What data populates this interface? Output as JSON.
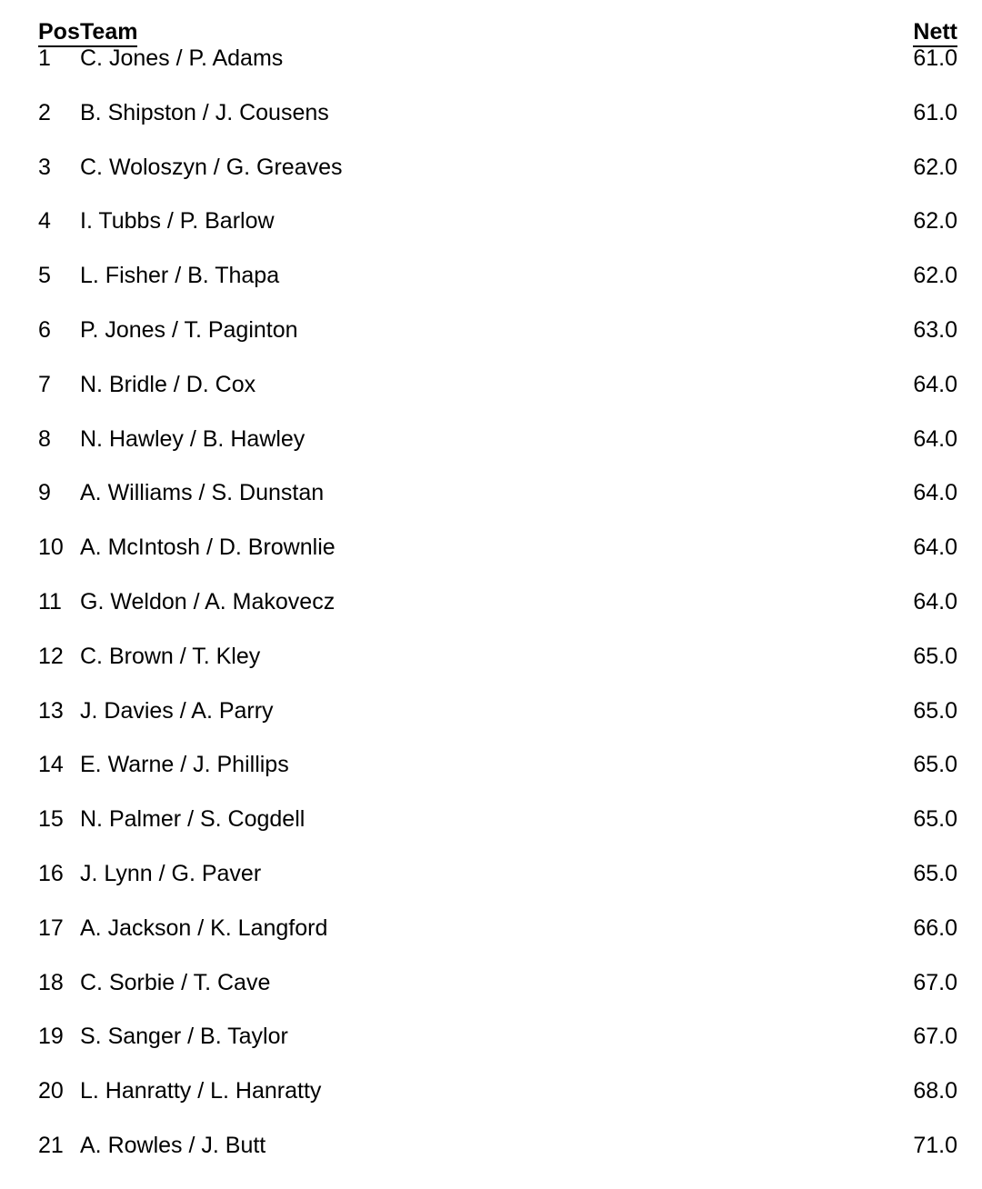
{
  "table": {
    "columns": {
      "pos": "Pos",
      "team": "Team",
      "nett": "Nett"
    },
    "rows": [
      {
        "pos": "1",
        "team": "C. Jones / P. Adams",
        "nett": "61.0"
      },
      {
        "pos": "2",
        "team": "B. Shipston / J. Cousens",
        "nett": "61.0"
      },
      {
        "pos": "3",
        "team": "C. Woloszyn / G. Greaves",
        "nett": "62.0"
      },
      {
        "pos": "4",
        "team": "I. Tubbs / P. Barlow",
        "nett": "62.0"
      },
      {
        "pos": "5",
        "team": "L. Fisher / B. Thapa",
        "nett": "62.0"
      },
      {
        "pos": "6",
        "team": "P. Jones / T. Paginton",
        "nett": "63.0"
      },
      {
        "pos": "7",
        "team": "N. Bridle / D. Cox",
        "nett": "64.0"
      },
      {
        "pos": "8",
        "team": "N. Hawley / B. Hawley",
        "nett": "64.0"
      },
      {
        "pos": "9",
        "team": "A. Williams / S. Dunstan",
        "nett": "64.0"
      },
      {
        "pos": "10",
        "team": "A. McIntosh / D. Brownlie",
        "nett": "64.0"
      },
      {
        "pos": "11",
        "team": "G. Weldon / A. Makovecz",
        "nett": "64.0"
      },
      {
        "pos": "12",
        "team": "C. Brown / T. Kley",
        "nett": "65.0"
      },
      {
        "pos": "13",
        "team": "J. Davies / A. Parry",
        "nett": "65.0"
      },
      {
        "pos": "14",
        "team": "E. Warne / J. Phillips",
        "nett": "65.0"
      },
      {
        "pos": "15",
        "team": "N. Palmer / S. Cogdell",
        "nett": "65.0"
      },
      {
        "pos": "16",
        "team": "J. Lynn / G. Paver",
        "nett": "65.0"
      },
      {
        "pos": "17",
        "team": "A. Jackson / K. Langford",
        "nett": "66.0"
      },
      {
        "pos": "18",
        "team": "C. Sorbie / T. Cave",
        "nett": "67.0"
      },
      {
        "pos": "19",
        "team": "S. Sanger / B. Taylor",
        "nett": "67.0"
      },
      {
        "pos": "20",
        "team": "L. Hanratty / L. Hanratty",
        "nett": "68.0"
      },
      {
        "pos": "21",
        "team": "A. Rowles / J. Butt",
        "nett": "71.0"
      }
    ]
  },
  "theme": {
    "text_color": "#000000",
    "background_color": "#ffffff"
  }
}
